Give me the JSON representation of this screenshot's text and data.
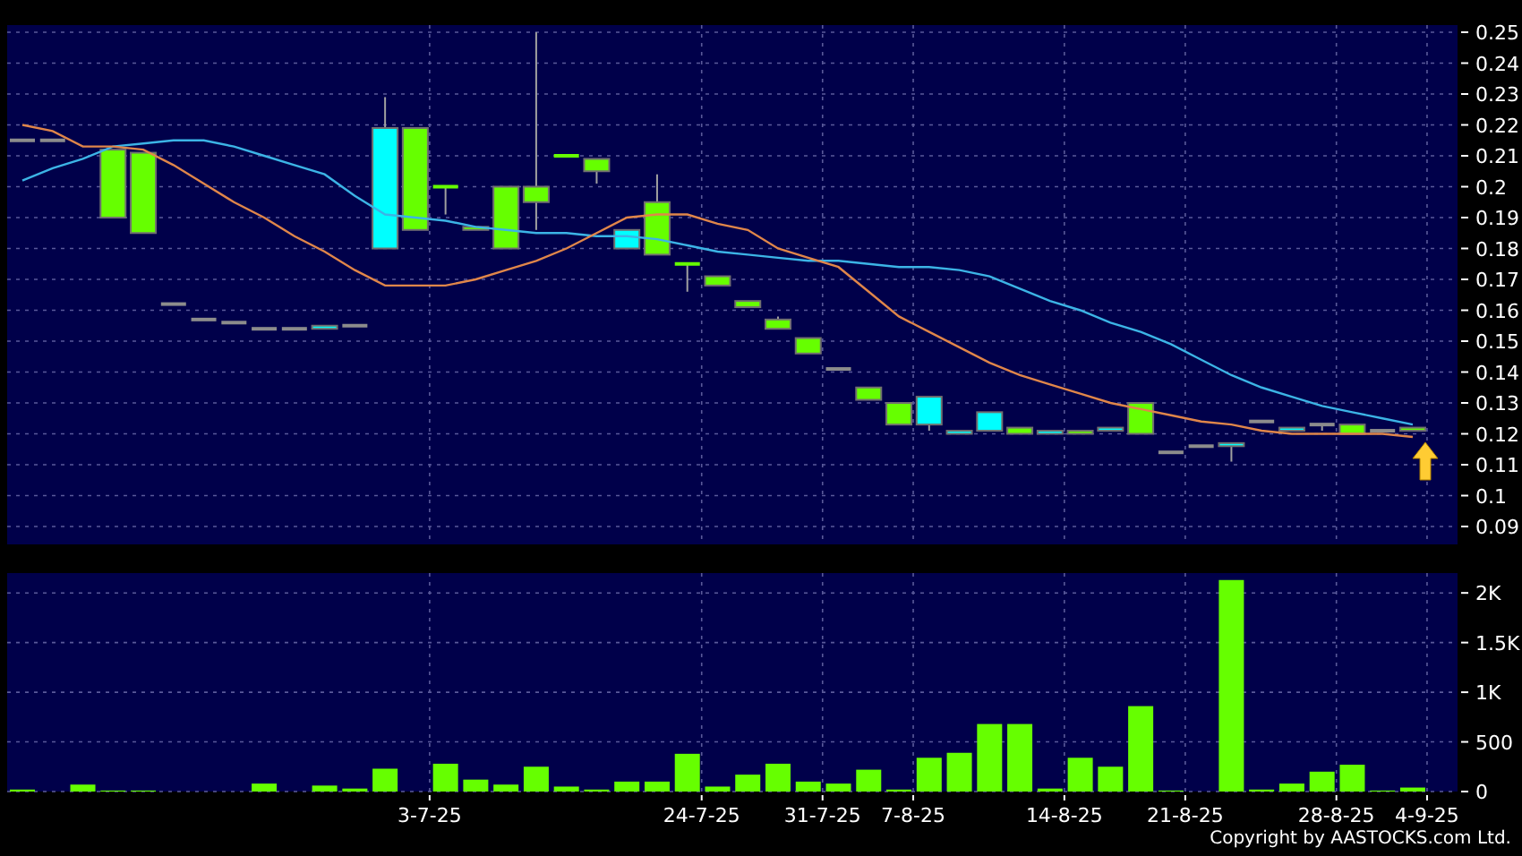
{
  "price_panel": {
    "chart_data": {
      "type": "line",
      "grid": true,
      "ylim": [
        0.09,
        0.25
      ],
      "yticks": [
        {
          "value": 0.25,
          "label": "0.25"
        },
        {
          "value": 0.24,
          "label": "0.24"
        },
        {
          "value": 0.23,
          "label": "0.23"
        },
        {
          "value": 0.22,
          "label": "0.22"
        },
        {
          "value": 0.21,
          "label": "0.21"
        },
        {
          "value": 0.2,
          "label": "0.2"
        },
        {
          "value": 0.19,
          "label": "0.19"
        },
        {
          "value": 0.18,
          "label": "0.18"
        },
        {
          "value": 0.17,
          "label": "0.17"
        },
        {
          "value": 0.16,
          "label": "0.16"
        },
        {
          "value": 0.15,
          "label": "0.15"
        },
        {
          "value": 0.14,
          "label": "0.14"
        },
        {
          "value": 0.13,
          "label": "0.13"
        },
        {
          "value": 0.12,
          "label": "0.12"
        },
        {
          "value": 0.11,
          "label": "0.11"
        },
        {
          "value": 0.1,
          "label": "0.1"
        },
        {
          "value": 0.09,
          "label": "0.09"
        }
      ],
      "series": [
        {
          "color": "#3cb4e6",
          "values": [
            0.202,
            0.206,
            0.209,
            0.213,
            0.214,
            0.215,
            0.215,
            0.213,
            0.21,
            0.207,
            0.204,
            0.197,
            0.191,
            0.19,
            0.189,
            0.187,
            0.186,
            0.185,
            0.185,
            0.184,
            0.184,
            0.183,
            0.181,
            0.179,
            0.178,
            0.177,
            0.176,
            0.176,
            0.175,
            0.174,
            0.174,
            0.173,
            0.171,
            0.167,
            0.163,
            0.16,
            0.156,
            0.153,
            0.149,
            0.144,
            0.139,
            0.135,
            0.132,
            0.129,
            0.127,
            0.125,
            0.123
          ]
        },
        {
          "color": "#e0864a",
          "values": [
            0.22,
            0.218,
            0.213,
            0.213,
            0.212,
            0.207,
            0.201,
            0.195,
            0.19,
            0.184,
            0.179,
            0.173,
            0.168,
            0.168,
            0.168,
            0.17,
            0.173,
            0.176,
            0.18,
            0.185,
            0.19,
            0.191,
            0.191,
            0.188,
            0.186,
            0.18,
            0.177,
            0.174,
            0.166,
            0.158,
            0.153,
            0.148,
            0.143,
            0.139,
            0.136,
            0.133,
            0.13,
            0.128,
            0.126,
            0.124,
            0.123,
            0.121,
            0.12,
            0.12,
            0.12,
            0.12,
            0.119
          ]
        }
      ]
    }
  },
  "volume_panel": {
    "chart_data": {
      "type": "bar",
      "grid": true,
      "ylim": [
        0,
        2200
      ],
      "categories": [
        null,
        null,
        null,
        null,
        null,
        null,
        null,
        null,
        null,
        null,
        null,
        null,
        null,
        "3-7-25",
        null,
        null,
        null,
        null,
        null,
        null,
        null,
        null,
        "24-7-25",
        null,
        null,
        null,
        "31-7-25",
        null,
        null,
        "7-8-25",
        null,
        null,
        null,
        null,
        "14-8-25",
        null,
        null,
        null,
        "21-8-25",
        null,
        null,
        null,
        null,
        "28-8-25",
        null,
        null,
        "4-9-25"
      ],
      "yticks": [
        {
          "value": 2000,
          "label": "2K"
        },
        {
          "value": 1500,
          "label": "1.5K"
        },
        {
          "value": 1000,
          "label": "1K"
        },
        {
          "value": 500,
          "label": "500"
        },
        {
          "value": 0,
          "label": "0"
        }
      ],
      "series": [
        {
          "color": "#66ff00",
          "values": [
            20,
            0,
            70,
            10,
            10,
            0,
            0,
            0,
            80,
            0,
            60,
            30,
            230,
            0,
            280,
            120,
            70,
            250,
            50,
            20,
            100,
            100,
            380,
            50,
            170,
            280,
            100,
            80,
            220,
            20,
            340,
            390,
            680,
            680,
            30,
            340,
            250,
            860,
            10,
            0,
            2130,
            20,
            80,
            200,
            270,
            10,
            40
          ]
        }
      ]
    }
  },
  "copyright": "Copyright by AASTOCKS.com Ltd."
}
